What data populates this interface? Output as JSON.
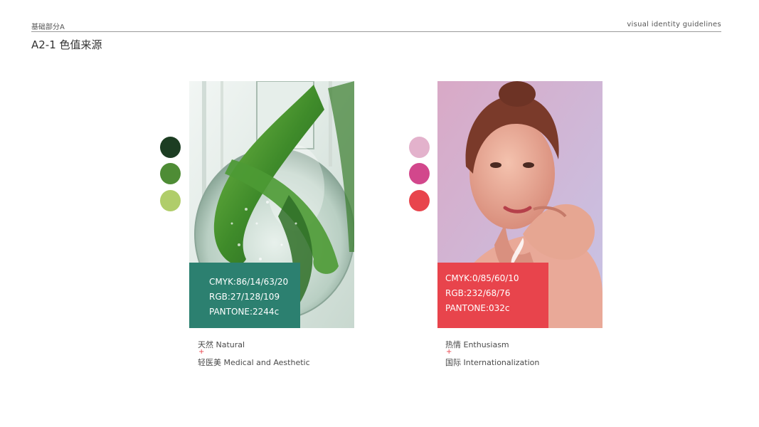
{
  "header": {
    "section": "基础部分A",
    "guidelines": "visual identity guidelines",
    "title": "A2-1 色值来源"
  },
  "panels": [
    {
      "swatches": [
        "#1c3d22",
        "#4e8c35",
        "#b0cd6a"
      ],
      "card_color": "#2c8070",
      "spec": {
        "cmyk": "CMYK:86/14/63/20",
        "rgb": "RGB:27/128/109",
        "pantone": "PANTONE:2244c"
      },
      "caption": {
        "line1": "天然 Natural",
        "plus": "+",
        "line2": "轻医美 Medical and Aesthetic"
      }
    },
    {
      "swatches": [
        "#e3b2cc",
        "#d2478c",
        "#e8444c"
      ],
      "card_color": "#e8444c",
      "spec": {
        "cmyk": "CMYK:0/85/60/10",
        "rgb": "RGB:232/68/76",
        "pantone": "PANTONE:032c"
      },
      "caption": {
        "line1": "热情 Enthusiasm",
        "plus": "+",
        "line2": "国际 Internationalization"
      }
    }
  ]
}
